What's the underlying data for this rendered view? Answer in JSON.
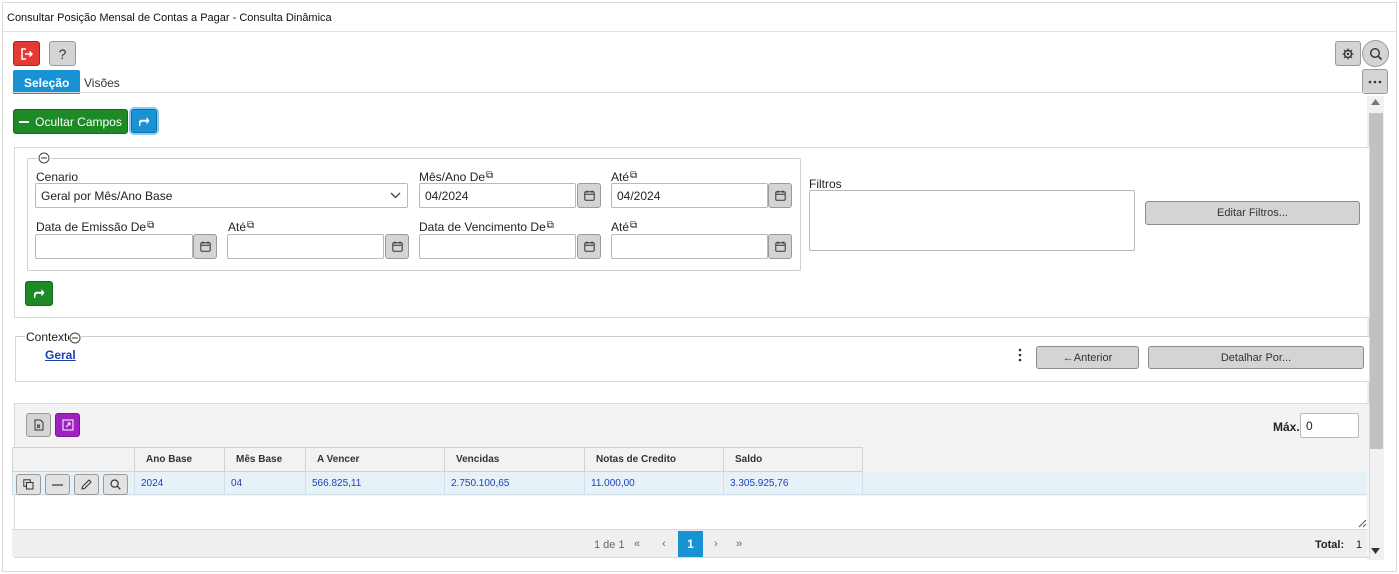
{
  "window": {
    "title": "Consultar Posição Mensal de Contas a Pagar - Consulta Dinâmica"
  },
  "toolbar": {
    "exit_icon": "exit-icon",
    "help_label": "?"
  },
  "tabs": [
    {
      "label": "Seleção",
      "active": true
    },
    {
      "label": "Visões",
      "active": false
    }
  ],
  "actions": {
    "hide_fields_label": "Ocultar Campos"
  },
  "form": {
    "cenario": {
      "label": "Cenario",
      "value": "Geral por Mês/Ano Base"
    },
    "mes_ano_de": {
      "label": "Mês/Ano De",
      "value": "04/2024"
    },
    "mes_ano_ate": {
      "label": "Até",
      "value": "04/2024"
    },
    "data_emissao_de": {
      "label": "Data de Emissão De",
      "value": ""
    },
    "data_emissao_ate": {
      "label": "Até",
      "value": ""
    },
    "data_vencimento_de": {
      "label": "Data de Vencimento De",
      "value": ""
    },
    "data_vencimento_ate": {
      "label": "Até",
      "value": ""
    },
    "filtros_label": "Filtros",
    "edit_filters_label": "Editar Filtros..."
  },
  "context": {
    "label": "Contexto",
    "link": "Geral",
    "previous_label": "←Anterior",
    "detail_label": "Detalhar Por..."
  },
  "grid": {
    "max_label": "Máx.",
    "max_value": "0",
    "columns": [
      "Ano Base",
      "Mês Base",
      "A Vencer",
      "Vencidas",
      "Notas de Credito",
      "Saldo"
    ],
    "rows": [
      [
        "2024",
        "04",
        "566.825,11",
        "2.750.100,65",
        "11.000,00",
        "3.305.925,76"
      ]
    ],
    "pager": {
      "page_info": "1 de 1",
      "current_page": "1",
      "total_label": "Total:",
      "total_value": "1"
    }
  },
  "colors": {
    "accent_blue": "#1992d4",
    "green": "#1e8a26",
    "red": "#e53935",
    "purple": "#a020c0"
  }
}
